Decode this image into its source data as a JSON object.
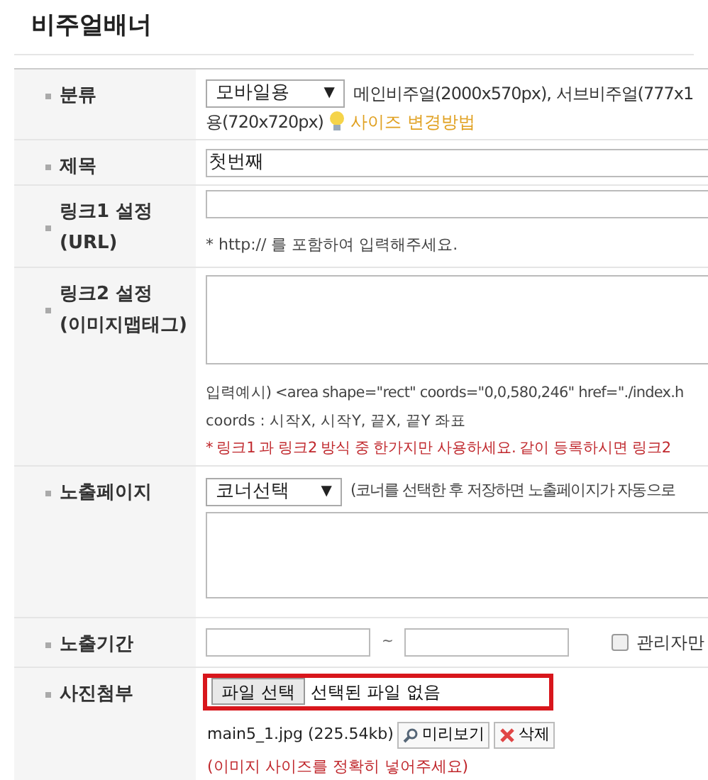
{
  "title": "비주얼배너",
  "category": {
    "label": "분류",
    "select": {
      "value": "모바일용",
      "arrow": "▼"
    },
    "note": "메인비주얼(2000x570px), 서브비주얼(777x1",
    "note_cont": "용(720x720px)",
    "help_link": "사이즈 변경방법"
  },
  "subject": {
    "label": "제목",
    "value": "첫번째"
  },
  "link1": {
    "label_lines": [
      "링크1 설정",
      "(URL)"
    ],
    "hint": "* http:// 를 포함하여 입력해주세요."
  },
  "link2": {
    "label_lines": [
      "링크2 설정",
      "(이미지맵태그)"
    ],
    "example": "입력예시) <area shape=\"rect\" coords=\"0,0,580,246\" href=\"./index.h",
    "coords_hint": "coords : 시작X, 시작Y, 끝X, 끝Y 좌표",
    "warning": "* 링크1 과 링크2 방식 중 한가지만 사용하세요. 같이 등록하시면 링크2"
  },
  "page": {
    "label": "노출페이지",
    "select": {
      "value": "코너선택",
      "arrow": "▼"
    },
    "note": "(코너를 선택한 후 저장하면 노출페이지가 자동으로"
  },
  "period": {
    "label": "노출기간",
    "separator": "~",
    "admin_only": {
      "label": "관리자만",
      "checked": false
    }
  },
  "photo": {
    "label": "사진첨부",
    "file_button": "파일 선택",
    "file_status": "선택된 파일 없음",
    "highlighted": true,
    "current_file": "main5_1.jpg (225.54kb)",
    "preview_button": "미리보기",
    "delete_button": "삭제",
    "size_note": "(이미지 사이즈를 정확히 넣어주세요)"
  }
}
